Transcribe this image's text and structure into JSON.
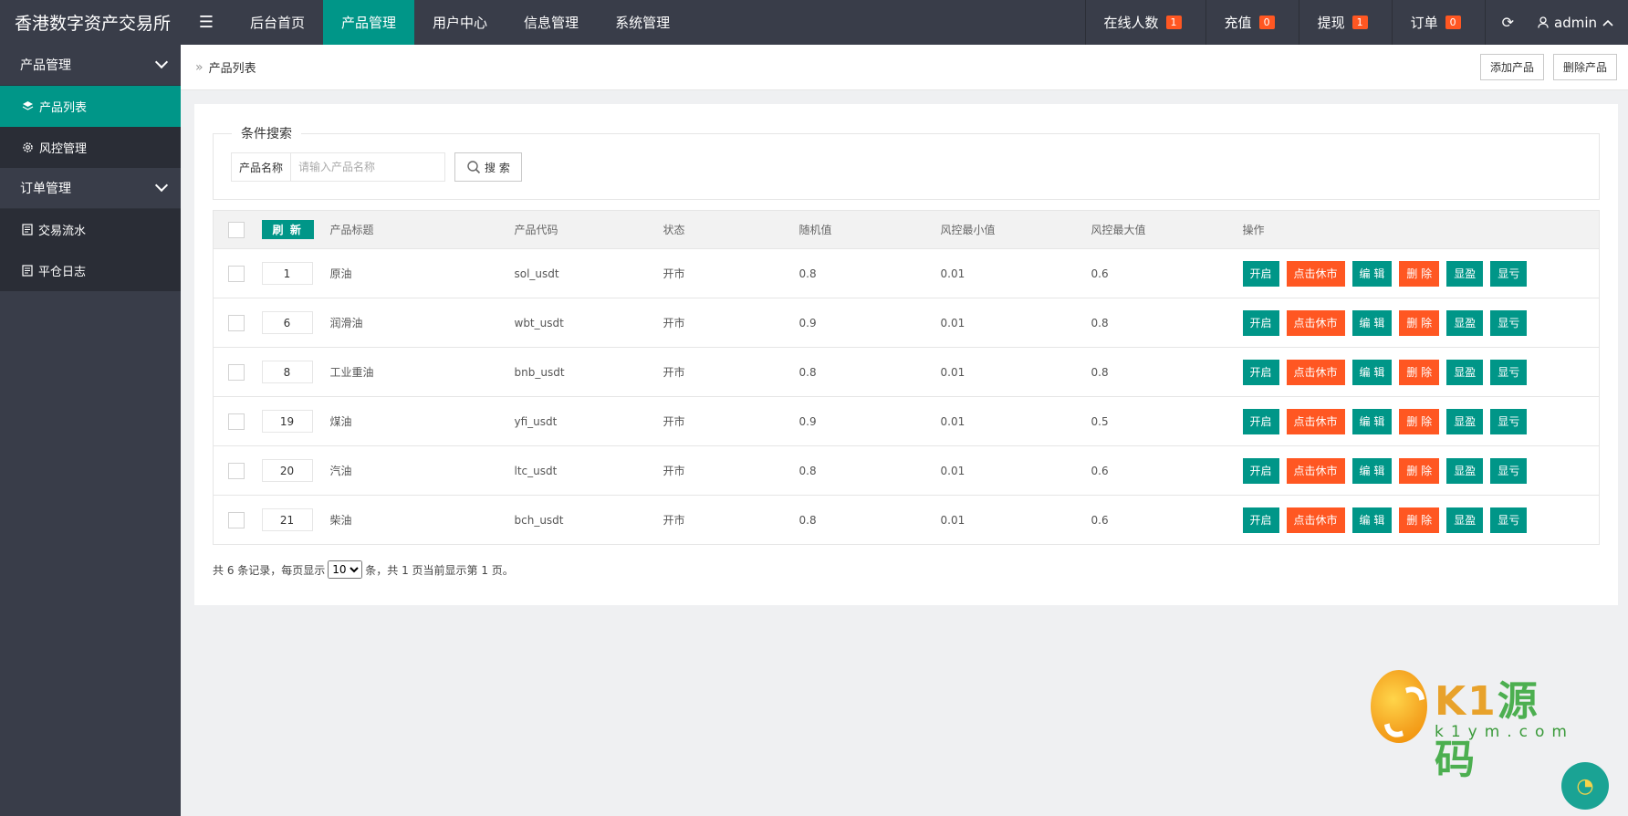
{
  "brand": "香港数字资产交易所",
  "nav": [
    "后台首页",
    "产品管理",
    "用户中心",
    "信息管理",
    "系统管理"
  ],
  "nav_active_index": 1,
  "right_nav": [
    {
      "label": "在线人数",
      "badge": "1"
    },
    {
      "label": "充值",
      "badge": "0"
    },
    {
      "label": "提现",
      "badge": "1"
    },
    {
      "label": "订单",
      "badge": "0"
    }
  ],
  "user": "admin",
  "sidebar": {
    "group1": "产品管理",
    "group1_items": [
      "产品列表",
      "风控管理"
    ],
    "group2": "订单管理",
    "group2_items": [
      "交易流水",
      "平仓日志"
    ]
  },
  "breadcrumb": "产品列表",
  "actions": {
    "add": "添加产品",
    "delete": "删除产品"
  },
  "search": {
    "legend": "条件搜索",
    "label": "产品名称",
    "placeholder": "请输入产品名称",
    "button": "搜 索"
  },
  "table": {
    "refresh": "刷 新",
    "headers": [
      "产品标题",
      "产品代码",
      "状态",
      "随机值",
      "风控最小值",
      "风控最大值",
      "操作"
    ],
    "rows": [
      {
        "sort": "1",
        "title": "原油",
        "code": "sol_usdt",
        "status": "开市",
        "random": "0.8",
        "min": "0.01",
        "max": "0.6"
      },
      {
        "sort": "6",
        "title": "润滑油",
        "code": "wbt_usdt",
        "status": "开市",
        "random": "0.9",
        "min": "0.01",
        "max": "0.8"
      },
      {
        "sort": "8",
        "title": "工业重油",
        "code": "bnb_usdt",
        "status": "开市",
        "random": "0.8",
        "min": "0.01",
        "max": "0.8"
      },
      {
        "sort": "19",
        "title": "煤油",
        "code": "yfi_usdt",
        "status": "开市",
        "random": "0.9",
        "min": "0.01",
        "max": "0.5"
      },
      {
        "sort": "20",
        "title": "汽油",
        "code": "ltc_usdt",
        "status": "开市",
        "random": "0.8",
        "min": "0.01",
        "max": "0.6"
      },
      {
        "sort": "21",
        "title": "柴油",
        "code": "bch_usdt",
        "status": "开市",
        "random": "0.8",
        "min": "0.01",
        "max": "0.6"
      }
    ],
    "ops": [
      "开启",
      "点击休市",
      "编 辑",
      "删 除",
      "显盈",
      "显亏"
    ]
  },
  "pager": {
    "prefix": "共 6 条记录，每页显示",
    "per_page": "10",
    "suffix": "条，共 1 页当前显示第 1 页。"
  },
  "watermark": {
    "k": "K1",
    "cn": "源码",
    "sub": "k1ym.com"
  },
  "colors": {
    "teal": "#009688",
    "orange": "#ff5722",
    "dark": "#393d49"
  }
}
